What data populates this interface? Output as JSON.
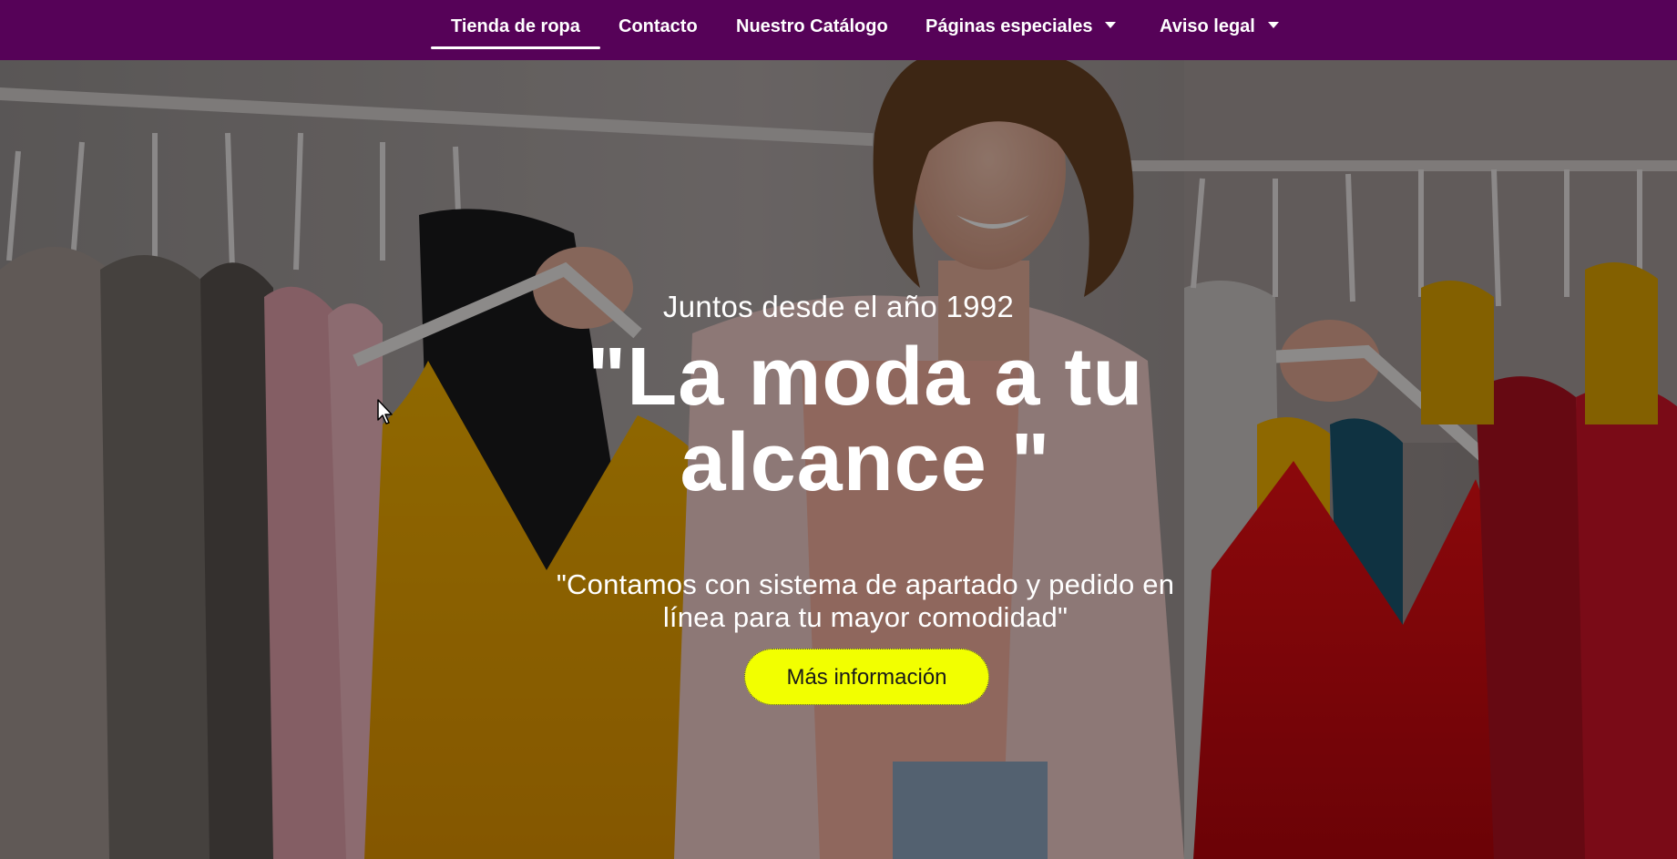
{
  "nav": {
    "items": [
      {
        "label": "Tienda de ropa",
        "active": true,
        "has_dropdown": false
      },
      {
        "label": "Contacto",
        "active": false,
        "has_dropdown": false
      },
      {
        "label": "Nuestro Catálogo",
        "active": false,
        "has_dropdown": false
      },
      {
        "label": "Páginas especiales",
        "active": false,
        "has_dropdown": true
      },
      {
        "label": "Aviso legal",
        "active": false,
        "has_dropdown": true
      }
    ]
  },
  "hero": {
    "eyebrow": "Juntos desde el año 1992",
    "headline_line1": "\"La moda a tu",
    "headline_line2": "alcance \"",
    "subtitle_line1": "\"Contamos con sistema de apartado y pedido en",
    "subtitle_line2": "línea para tu mayor comodidad\"",
    "cta_label": "Más información"
  },
  "colors": {
    "nav_background": "#560258",
    "cta_background": "#f2ff00",
    "text": "#ffffff"
  },
  "icons": {
    "dropdown": "chevron-down-icon",
    "cursor": "mouse-pointer-icon"
  }
}
